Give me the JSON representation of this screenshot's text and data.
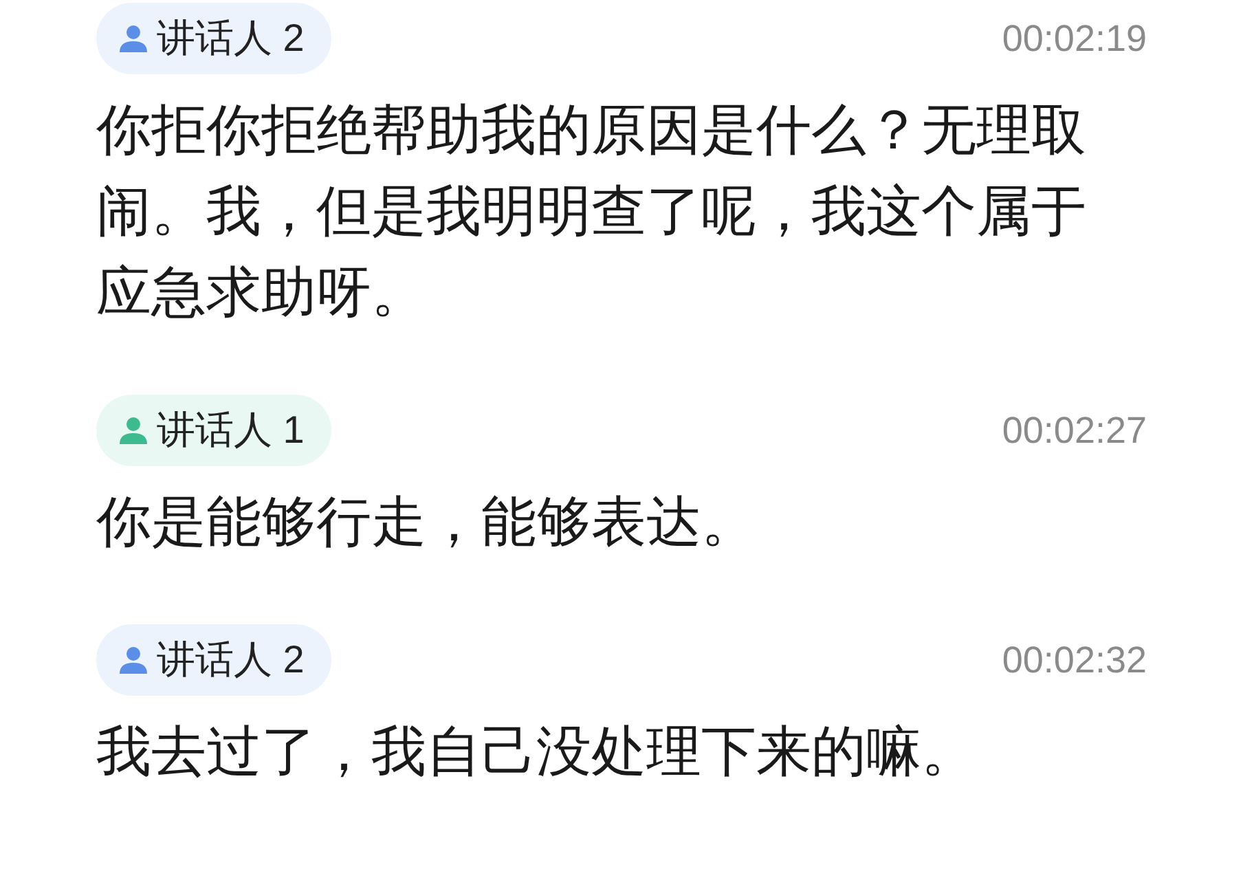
{
  "entries": [
    {
      "speaker": "讲话人 2",
      "color": "#5b8ee6",
      "time": "00:02:19",
      "text": "你拒你拒绝帮助我的原因是什么？无理取闹。我，但是我明明查了呢，我这个属于应急求助呀。"
    },
    {
      "speaker": "讲话人 1",
      "color": "#3dbb8f",
      "time": "00:02:27",
      "text": "你是能够行走，能够表达。"
    },
    {
      "speaker": "讲话人 2",
      "color": "#5b8ee6",
      "time": "00:02:32",
      "text": "我去过了，我自己没处理下来的嘛。"
    }
  ]
}
